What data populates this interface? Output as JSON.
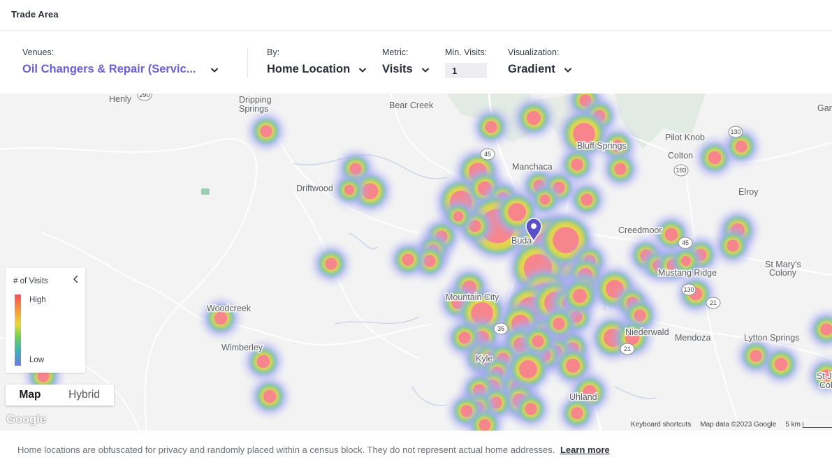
{
  "header": {
    "title": "Trade Area"
  },
  "controls": {
    "venues": {
      "label": "Venues:",
      "value": "Oil Changers & Repair (Servic..."
    },
    "by": {
      "label": "By:",
      "value": "Home Location"
    },
    "metric": {
      "label": "Metric:",
      "value": "Visits"
    },
    "min_visits": {
      "label": "Min. Visits:",
      "value": "1"
    },
    "visualization": {
      "label": "Visualization:",
      "value": "Gradient"
    }
  },
  "map": {
    "place_labels": [
      "Henly",
      "Dripping",
      "Springs",
      "Bear Creek",
      "Gar",
      "Pilot Knob",
      "Bluff Springs",
      "Colton",
      "Manchaca",
      "Driftwood",
      "Elroy",
      "Creedmoor",
      "Buda",
      "Mustang Ridge",
      "St Mary's",
      "Colony",
      "Mountain City",
      "Woodcreek",
      "Niederwald",
      "Mendoza",
      "Wimberley",
      "Lytton Springs",
      "Kyle",
      "St Jo",
      "Colo",
      "Uhland"
    ],
    "road_shields": [
      "290",
      "130",
      "45",
      "183",
      "45",
      "130",
      "35",
      "21",
      "21"
    ],
    "legend": {
      "title": "# of Visits",
      "high": "High",
      "low": "Low",
      "colors": [
        "#f0505a",
        "#f79a3c",
        "#e7d83c",
        "#6fcf58",
        "#3fb5b0",
        "#6d7de2"
      ]
    },
    "map_type": {
      "map": "Map",
      "hybrid": "Hybrid",
      "selected": "Map"
    },
    "google_logo": "Google",
    "attribution": {
      "shortcuts": "Keyboard shortcuts",
      "data": "Map data ©2023 Google",
      "scale": "5 km"
    },
    "venue_pin_icon": "map-pin-icon"
  },
  "footer": {
    "note": "Home locations are obfuscated for privacy and randomly placed within a census block. They do not represent actual home addresses.",
    "learn_more": "Learn more"
  },
  "colors": {
    "accent": "#6a5fd6",
    "heat_high": "#f47f86",
    "heat_low": "#9b9cf0"
  }
}
